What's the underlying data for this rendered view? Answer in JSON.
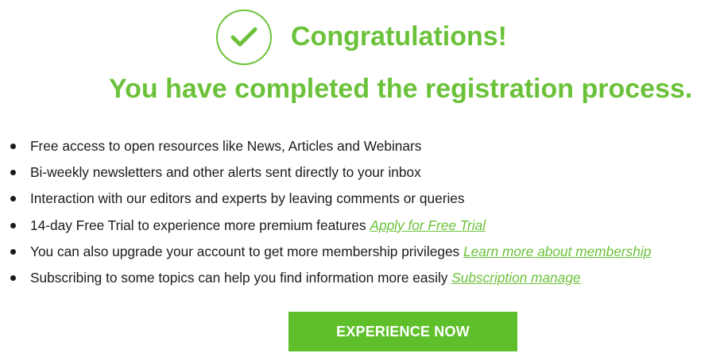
{
  "header": {
    "check_icon": "check-circle-icon",
    "title": "Congratulations!",
    "subtitle": "You have completed the registration process."
  },
  "benefits": [
    {
      "text": "Free access to open resources like News, Articles and Webinars",
      "link": ""
    },
    {
      "text": "Bi-weekly newsletters and other alerts sent directly to your inbox",
      "link": ""
    },
    {
      "text": "Interaction with our editors and experts by leaving comments or queries",
      "link": ""
    },
    {
      "text": "14-day Free Trial to experience more premium features",
      "link": "Apply for Free Trial"
    },
    {
      "text": "You can also upgrade your account to get more membership privileges",
      "link": "Learn more about membership"
    },
    {
      "text": "Subscribing to some topics can help you find information more easily",
      "link": "Subscription manage"
    }
  ],
  "cta": {
    "label": "EXPERIENCE NOW"
  },
  "colors": {
    "accent": "#6bc23a",
    "button": "#5fbf2b",
    "text": "#1a1a1a"
  }
}
